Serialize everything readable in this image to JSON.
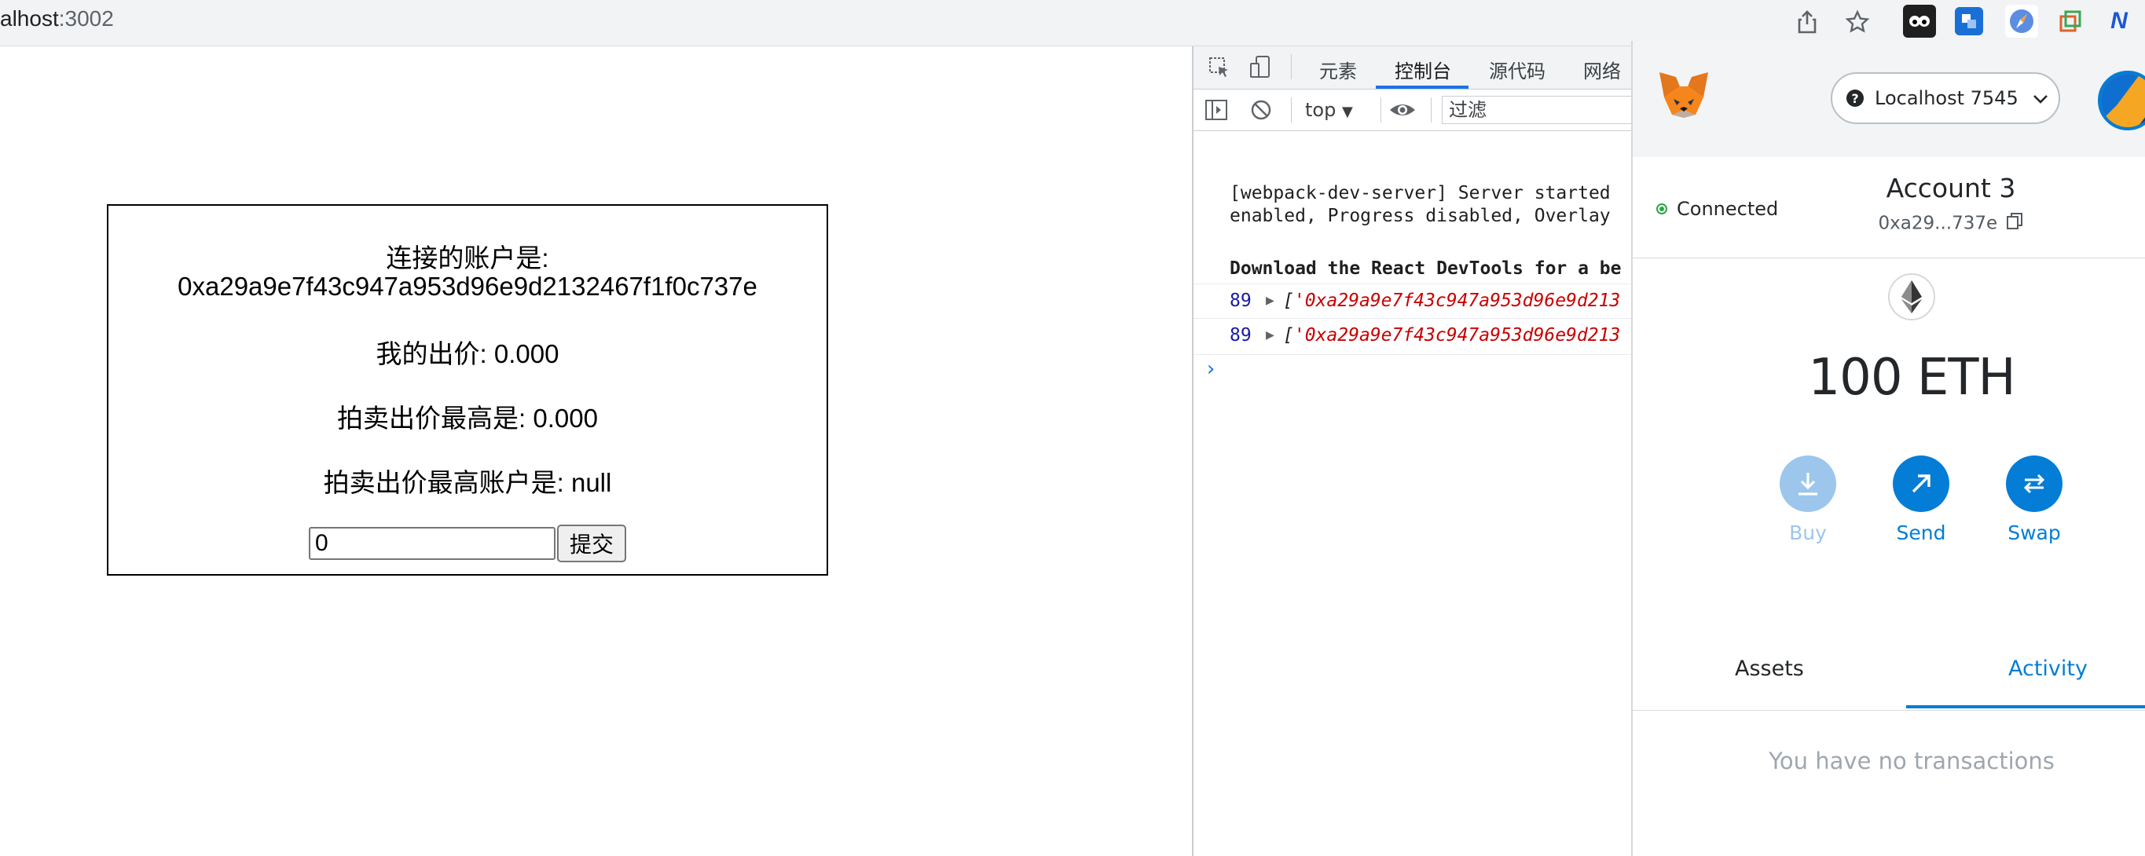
{
  "browser": {
    "url_host": "alhost",
    "url_port": ":3002",
    "icons": [
      "share-icon",
      "star-icon",
      "ext-panda-icon",
      "ext-translate-icon",
      "ext-compass-icon",
      "ext-copy-icon",
      "ext-n-icon"
    ],
    "ext_n_label": "N"
  },
  "page": {
    "account_label": "连接的账户是:",
    "account_address": "0xa29a9e7f43c947a953d96e9d2132467f1f0c737e",
    "my_bid": "我的出价: 0.000",
    "highest_bid": "拍卖出价最高是: 0.000",
    "highest_bidder": "拍卖出价最高账户是: null",
    "bid_input_value": "0",
    "submit_label": "提交"
  },
  "devtools": {
    "tabs": [
      {
        "label": "元素"
      },
      {
        "label": "控制台"
      },
      {
        "label": "源代码"
      },
      {
        "label": "网络"
      }
    ],
    "active_tab": "控制台",
    "context": "top",
    "filter_placeholder": "过滤",
    "console": {
      "line1": "[webpack-dev-server] Server started",
      "line2": "enabled, Progress disabled, Overlay",
      "line3": "Download the React DevTools for a be",
      "rows": [
        {
          "num": "89",
          "text": "'0xa29a9e7f43c947a953d96e9d213"
        },
        {
          "num": "89",
          "text": "'0xa29a9e7f43c947a953d96e9d213"
        }
      ]
    }
  },
  "metamask": {
    "network": "Localhost 7545",
    "connected": "Connected",
    "account_name": "Account 3",
    "account_short": "0xa29...737e",
    "balance": "100 ETH",
    "actions": [
      {
        "label": "Buy",
        "color": "#037dd6",
        "disabled": true
      },
      {
        "label": "Send",
        "color": "#037dd6",
        "disabled": false
      },
      {
        "label": "Swap",
        "color": "#037dd6",
        "disabled": false
      }
    ],
    "tabs": [
      {
        "label": "Assets"
      },
      {
        "label": "Activity"
      }
    ],
    "active_tab": "Activity",
    "empty_text": "You have no transactions",
    "accent_color": "#037dd6"
  }
}
